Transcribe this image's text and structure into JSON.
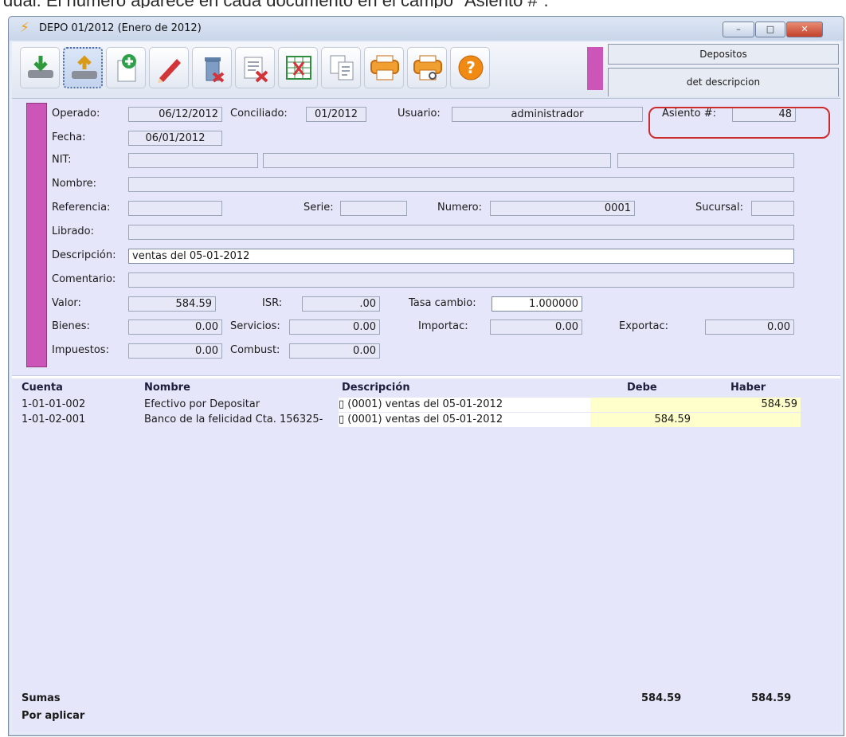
{
  "caption": "dual. El número aparece en cada documento en el campo \"Asiento #\".",
  "window": {
    "title": "DEPO 01/2012 (Enero de 2012)",
    "icon": "lightning-icon",
    "controls": {
      "minimize": "–",
      "maximize": "□",
      "close": "✕"
    }
  },
  "toolbar": {
    "buttons": [
      "import-icon",
      "export-icon",
      "add-icon",
      "edit-icon",
      "delete-icon",
      "cancel-document-icon",
      "grid-icon",
      "copy-icon",
      "print-icon",
      "print-preview-icon",
      "help-icon"
    ],
    "panel_title": "Depositos",
    "panel_subtitle": "det descripcion",
    "accent": "#cc55b8"
  },
  "header": {
    "operado_label": "Operado:",
    "operado": "06/12/2012",
    "conciliado_label": "Conciliado:",
    "conciliado": "01/2012",
    "usuario_label": "Usuario:",
    "usuario": "administrador",
    "asiento_label": "Asiento #:",
    "asiento": "48",
    "fecha_label": "Fecha:",
    "fecha": "06/01/2012",
    "nit_label": "NIT:",
    "nombre_label": "Nombre:",
    "referencia_label": "Referencia:",
    "serie_label": "Serie:",
    "numero_label": "Numero:",
    "numero": "0001",
    "sucursal_label": "Sucursal:",
    "librado_label": "Librado:",
    "descripcion_label": "Descripción:",
    "descripcion": "ventas del 05-01-2012",
    "comentario_label": "Comentario:",
    "valor_label": "Valor:",
    "valor": "584.59",
    "isr_label": "ISR:",
    "isr": ".00",
    "tasa_label": "Tasa cambio:",
    "tasa": "1.000000",
    "bienes_label": "Bienes:",
    "bienes": "0.00",
    "servicios_label": "Servicios:",
    "servicios": "0.00",
    "importac_label": "Importac:",
    "importac": "0.00",
    "exportac_label": "Exportac:",
    "exportac": "0.00",
    "impuestos_label": "Impuestos:",
    "impuestos": "0.00",
    "combust_label": "Combust:",
    "combust": "0.00",
    "highlight_color": "#cc2b2b"
  },
  "grid": {
    "columns": [
      "Cuenta",
      "Nombre",
      "Descripción",
      "Debe",
      "Haber"
    ],
    "rows": [
      {
        "cuenta": "1-01-01-002",
        "nombre": "Efectivo por Depositar",
        "descripcion": "▯ (0001) ventas del 05-01-2012",
        "debe": "",
        "haber": "584.59"
      },
      {
        "cuenta": "1-01-02-001",
        "nombre": "Banco de la felicidad Cta. 156325-",
        "descripcion": "▯ (0001) ventas del 05-01-2012",
        "debe": "584.59",
        "haber": ""
      }
    ],
    "sumas_label": "Sumas",
    "sumas_debe": "584.59",
    "sumas_haber": "584.59",
    "por_aplicar_label": "Por aplicar"
  }
}
